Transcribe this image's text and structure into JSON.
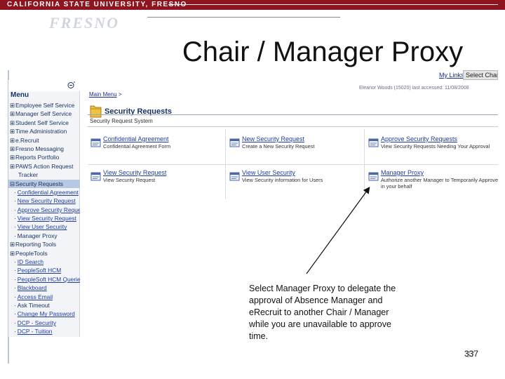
{
  "banner": {
    "university": "CALIFORNIA STATE UNIVERSITY, FRESNO",
    "seal_text": "FRESNO",
    "color": "#8e1520"
  },
  "slide": {
    "title": "Chair / Manager Proxy",
    "number": "337",
    "number_shadow": "37"
  },
  "portal": {
    "my_links": "My Links",
    "select_char": "Select Char.",
    "user_info": "Eleanor Woods (15020) last accessed: 11/08/2008"
  },
  "menu": {
    "header": "Menu",
    "collapse_icon": "collapse-icon",
    "items": [
      {
        "type": "folder",
        "glyph": "⊞",
        "label": "Employee Self Service"
      },
      {
        "type": "folder",
        "glyph": "⊞",
        "label": "Manager Self Service"
      },
      {
        "type": "folder",
        "glyph": "⊞",
        "label": "Student Self Service"
      },
      {
        "type": "folder",
        "glyph": "⊞",
        "label": "Time Administration"
      },
      {
        "type": "folder",
        "glyph": "⊞",
        "label": "e.Recruit"
      },
      {
        "type": "folder",
        "glyph": "⊞",
        "label": "Fresno Messaging"
      },
      {
        "type": "folder",
        "glyph": "⊞",
        "label": "Reports Portfolio"
      },
      {
        "type": "folder",
        "glyph": "⊞",
        "label": "PAWS Action Request"
      },
      {
        "type": "cont",
        "glyph": "",
        "label": "Tracker"
      },
      {
        "type": "folder-open",
        "glyph": "⊟",
        "label": "Security Requests"
      },
      {
        "type": "sub",
        "glyph": "·",
        "label": "Confidential Agreement"
      },
      {
        "type": "sub",
        "glyph": "·",
        "label": "New Security Request"
      },
      {
        "type": "sub",
        "glyph": "·",
        "label": "Approve Security Requests"
      },
      {
        "type": "sub",
        "glyph": "·",
        "label": "View Security Request"
      },
      {
        "type": "sub",
        "glyph": "·",
        "label": "View User Security"
      },
      {
        "type": "sub-plain",
        "glyph": "·",
        "label": "Manager Proxy"
      },
      {
        "type": "folder",
        "glyph": "⊞",
        "label": "Reporting Tools"
      },
      {
        "type": "folder",
        "glyph": "⊞",
        "label": "PeopleTools"
      },
      {
        "type": "sub",
        "glyph": "·",
        "label": "ID Search"
      },
      {
        "type": "sub",
        "glyph": "·",
        "label": "PeopleSoft HCM"
      },
      {
        "type": "sub",
        "glyph": "·",
        "label": "PeopleSoft HCM Queries"
      },
      {
        "type": "sub",
        "glyph": "·",
        "label": "Blackboard"
      },
      {
        "type": "sub",
        "glyph": "·",
        "label": "Access Email"
      },
      {
        "type": "sub-plain",
        "glyph": "·",
        "label": "Ask Timeout"
      },
      {
        "type": "sub",
        "glyph": "·",
        "label": "Change My Password"
      },
      {
        "type": "sub",
        "glyph": "·",
        "label": "DCP - Security"
      },
      {
        "type": "sub",
        "glyph": "·",
        "label": "DCP - Tuition"
      }
    ]
  },
  "content": {
    "breadcrumb_link": "Main Menu",
    "breadcrumb_sep": ">",
    "page_title": "Security Requests",
    "section_label": "Security Request System",
    "tiles": [
      {
        "title": "Confidential Agreement",
        "desc": "Confidential Agreement Form"
      },
      {
        "title": "New Security Request",
        "desc": "Create a New Security Request"
      },
      {
        "title": "Approve Security Requests",
        "desc": "View Security Requests Needing Your Approval"
      },
      {
        "title": "View Security Request",
        "desc": "View Security Request"
      },
      {
        "title": "View User Security",
        "desc": "View Security information for Users"
      },
      {
        "title": "Manager Proxy",
        "desc": "Authorize another Manager to Temporarily Approve in your behalf"
      }
    ]
  },
  "callout": {
    "text": "Select Manager Proxy to delegate the approval of Absence Manager and eRecruit to another Chair / Manager while you are unavailable to approve time."
  }
}
